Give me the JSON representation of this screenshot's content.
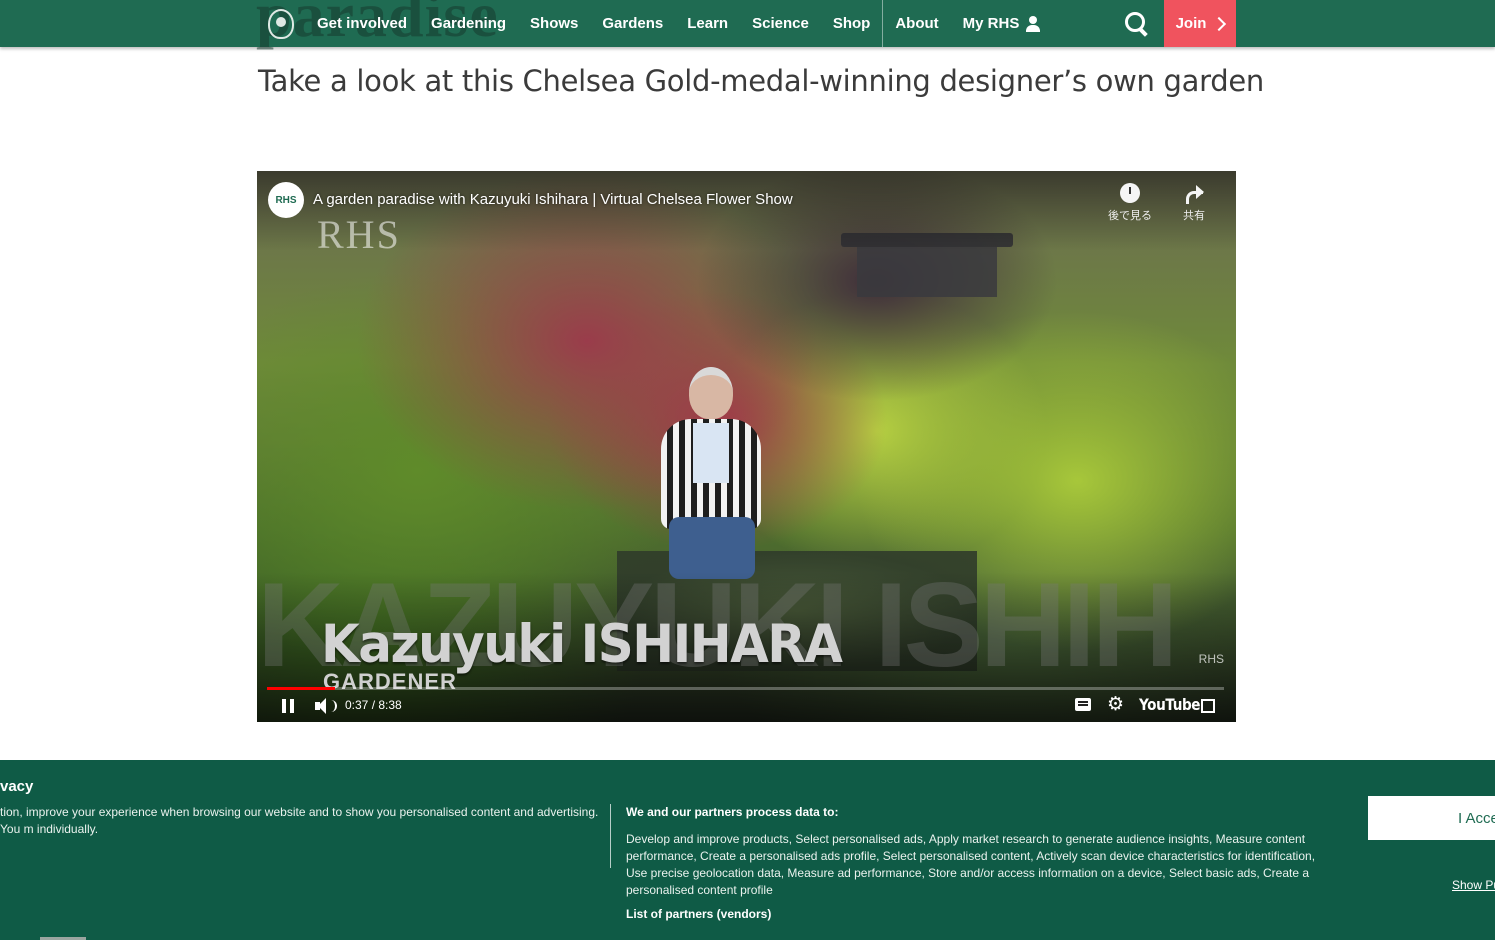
{
  "nav": {
    "ghost_heading": "paradise",
    "items": [
      "Get involved",
      "Gardening",
      "Shows",
      "Gardens",
      "Learn",
      "Science",
      "Shop"
    ],
    "secondary_items": [
      "About",
      "My RHS"
    ],
    "join_label": "Join",
    "colors": {
      "bar": "#1f6b52",
      "join": "#f0535e"
    }
  },
  "article": {
    "subtitle": "Take a look at this Chelsea Gold-medal-winning designer’s own garden"
  },
  "video": {
    "channel_avatar": "RHS",
    "title": "A garden paradise with Kazuyuki Ishihara | Virtual Chelsea Flower Show",
    "watermark": "RHS",
    "watch_later_label": "後で見る",
    "share_label": "共有",
    "name_caption": "Kazuyuki ISHIHARA",
    "role_caption": "GARDENER",
    "corner_bug": "RHS",
    "time": "0:37 / 8:38",
    "progress": 0.0714,
    "youtube_label": "YouTube"
  },
  "privacy": {
    "title": "vacy",
    "text": "tion, improve your experience when browsing our website and to show you personalised content and advertising. You m individually.",
    "purposes_heading": "We and our partners process data to:",
    "purposes_text": "Develop and improve products, Select personalised ads, Apply market research to generate audience insights, Measure content performance, Create a personalised ads profile, Select personalised content, Actively scan device characteristics for identification, Use precise geolocation data, Measure ad performance, Store and/or access information on a device, Select basic ads, Create a personalised content profile",
    "vendors_link": "List of partners (vendors)",
    "accept_label": "I Acce",
    "show_purposes_label": "Show Pu"
  }
}
